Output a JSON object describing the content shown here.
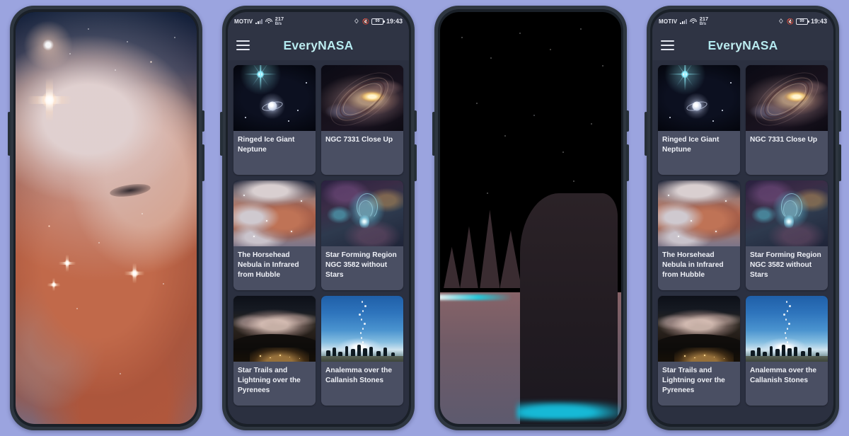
{
  "background_color": "#9ba4df",
  "phones": [
    {
      "name": "wallpaper-horsehead",
      "type": "wallpaper-horsehead"
    },
    {
      "name": "app-grid-left",
      "type": "app"
    },
    {
      "name": "wallpaper-milkyway",
      "type": "wallpaper-milkyway"
    },
    {
      "name": "app-grid-right",
      "type": "app"
    }
  ],
  "app": {
    "title": "EveryNASA",
    "title_color": "#a8e7ef",
    "menu_icon": "hamburger-menu-icon",
    "statusbar": {
      "carrier": "MOTIV",
      "signal_icon": "cell-signal-icon",
      "wifi_icon": "wifi-icon",
      "data_rate_value": "217",
      "data_rate_unit": "B/s",
      "bluetooth_icon": "bluetooth-icon",
      "vibrate_icon": "vibrate-mode-icon",
      "battery_icon": "battery-icon",
      "battery_level": "99",
      "time": "19:43"
    },
    "cards": [
      {
        "title": "Ringed Ice Giant Neptune",
        "art": "neptune"
      },
      {
        "title": "NGC 7331 Close Up",
        "art": "galaxy"
      },
      {
        "title": "The Horsehead Nebula in Infrared from Hubble",
        "art": "horsehead"
      },
      {
        "title": "Star Forming Region NGC 3582 without Stars",
        "art": "ngc3582"
      },
      {
        "title": "Star Trails and Lightning over the Pyrenees",
        "art": "startrails"
      },
      {
        "title": "Analemma over the Callanish Stones",
        "art": "analemma"
      }
    ]
  }
}
